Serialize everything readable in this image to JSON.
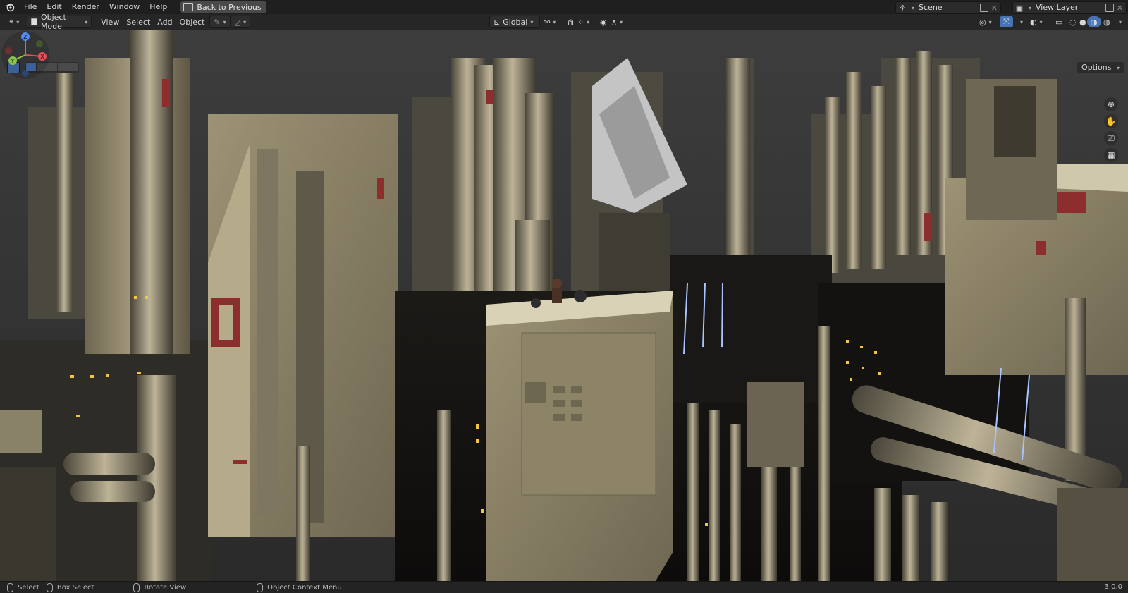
{
  "topbar": {
    "menu": [
      "File",
      "Edit",
      "Render",
      "Window",
      "Help"
    ],
    "back_button": "Back to Previous",
    "scene": "Scene",
    "view_layer": "View Layer"
  },
  "header": {
    "mode": "Object Mode",
    "menus": [
      "View",
      "Select",
      "Add",
      "Object"
    ],
    "orientation": "Global"
  },
  "viewport": {
    "options": "Options",
    "gizmo_axes": [
      "X",
      "Y",
      "Z"
    ]
  },
  "statusbar": {
    "select": "Select",
    "box_select": "Box Select",
    "rotate_view": "Rotate View",
    "context_menu": "Object Context Menu",
    "version": "3.0.0"
  },
  "colors": {
    "accent": "#4772b3",
    "x_axis": "#e94e5b",
    "y_axis": "#8bc34a",
    "z_axis": "#4f8df5"
  }
}
